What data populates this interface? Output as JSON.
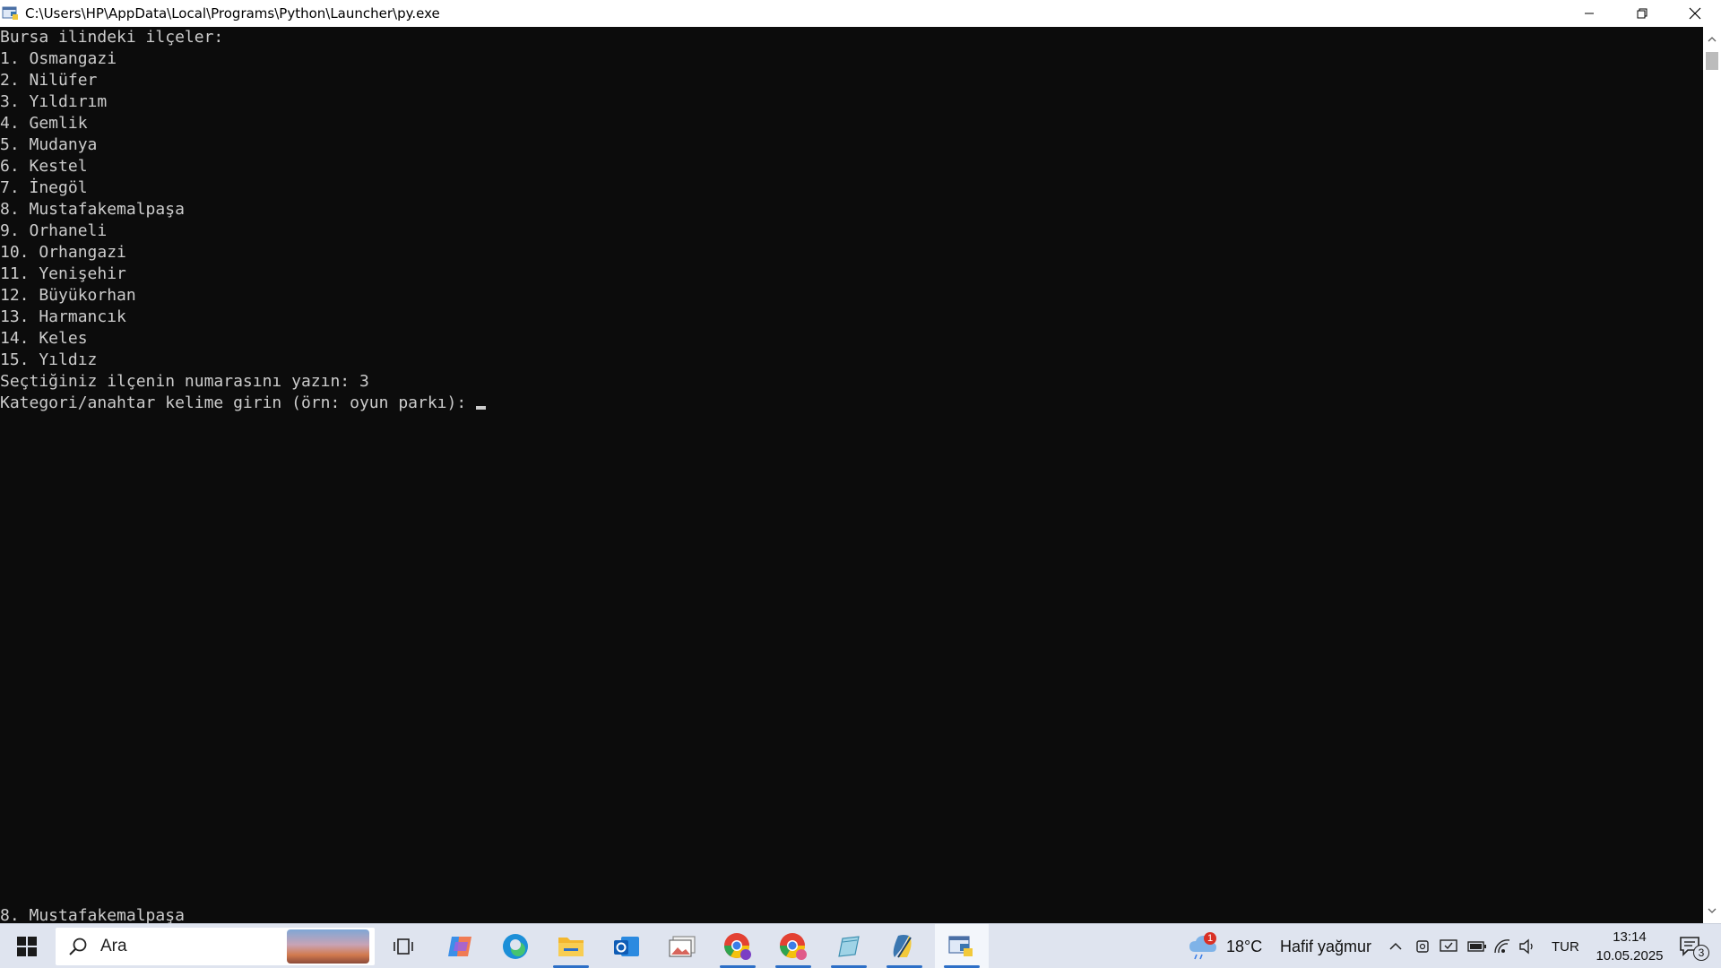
{
  "window": {
    "title": "C:\\Users\\HP\\AppData\\Local\\Programs\\Python\\Launcher\\py.exe",
    "icon": "python-launcher-icon",
    "controls": [
      "minimize-icon",
      "restore-icon",
      "close-icon"
    ]
  },
  "console": {
    "header": "Bursa ilindeki ilçeler:",
    "districts": [
      "1. Osmangazi",
      "2. Nilüfer",
      "3. Yıldırım",
      "4. Gemlik",
      "5. Mudanya",
      "6. Kestel",
      "7. İnegöl",
      "8. Mustafakemalpaşa",
      "9. Orhaneli",
      "10. Orhangazi",
      "11. Yenişehir",
      "12. Büyükorhan",
      "13. Harmancık",
      "14. Keles",
      "15. Yıldız"
    ],
    "selection_prompt": "Seçtiğiniz ilçenin numarasını yazın: 3",
    "keyword_prompt": "Kategori/anahtar kelime girin (örn: oyun parkı):",
    "bottom_overflow": "8. Mustafakemalpaşa"
  },
  "taskbar": {
    "search_label": "Ara",
    "apps": [
      "task-view-icon",
      "copilot-icon",
      "edge-icon",
      "file-explorer-icon",
      "outlook-icon",
      "photos-icon",
      "chrome-s-icon",
      "chrome-k-icon",
      "notepad-icon",
      "python-idle-icon",
      "python-launcher-icon"
    ],
    "weather": {
      "badge": "1",
      "temperature": "18°C",
      "condition": "Hafif yağmur"
    },
    "language": "TUR",
    "time": "13:14",
    "date": "10.05.2025",
    "notification_count": "3",
    "accent_color": "#2d6fc7"
  }
}
